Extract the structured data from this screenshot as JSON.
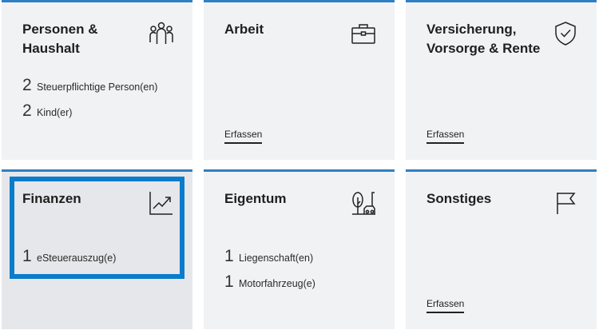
{
  "tiles": {
    "personen": {
      "title": "Personen & Haushalt",
      "icon": "people-group-icon",
      "stats": [
        {
          "count": "2",
          "label": "Steuerpflichtige Person(en)"
        },
        {
          "count": "2",
          "label": "Kind(er)"
        }
      ]
    },
    "arbeit": {
      "title": "Arbeit",
      "icon": "briefcase-icon",
      "link": "Erfassen"
    },
    "versicherung": {
      "title": "Versicherung, Vorsorge & Rente",
      "icon": "shield-check-icon",
      "link": "Erfassen"
    },
    "finanzen": {
      "title": "Finanzen",
      "icon": "trend-chart-icon",
      "stats": [
        {
          "count": "1",
          "label": "eSteuerauszug(e)"
        }
      ]
    },
    "eigentum": {
      "title": "Eigentum",
      "icon": "tree-car-icon",
      "stats": [
        {
          "count": "1",
          "label": "Liegenschaft(en)"
        },
        {
          "count": "1",
          "label": "Motorfahrzeug(e)"
        }
      ]
    },
    "sonstiges": {
      "title": "Sonstiges",
      "icon": "flag-icon",
      "link": "Erfassen"
    }
  },
  "colors": {
    "accent": "#2e7fc4",
    "highlight": "#0a7ccc",
    "tile_bg": "#f1f2f4"
  }
}
